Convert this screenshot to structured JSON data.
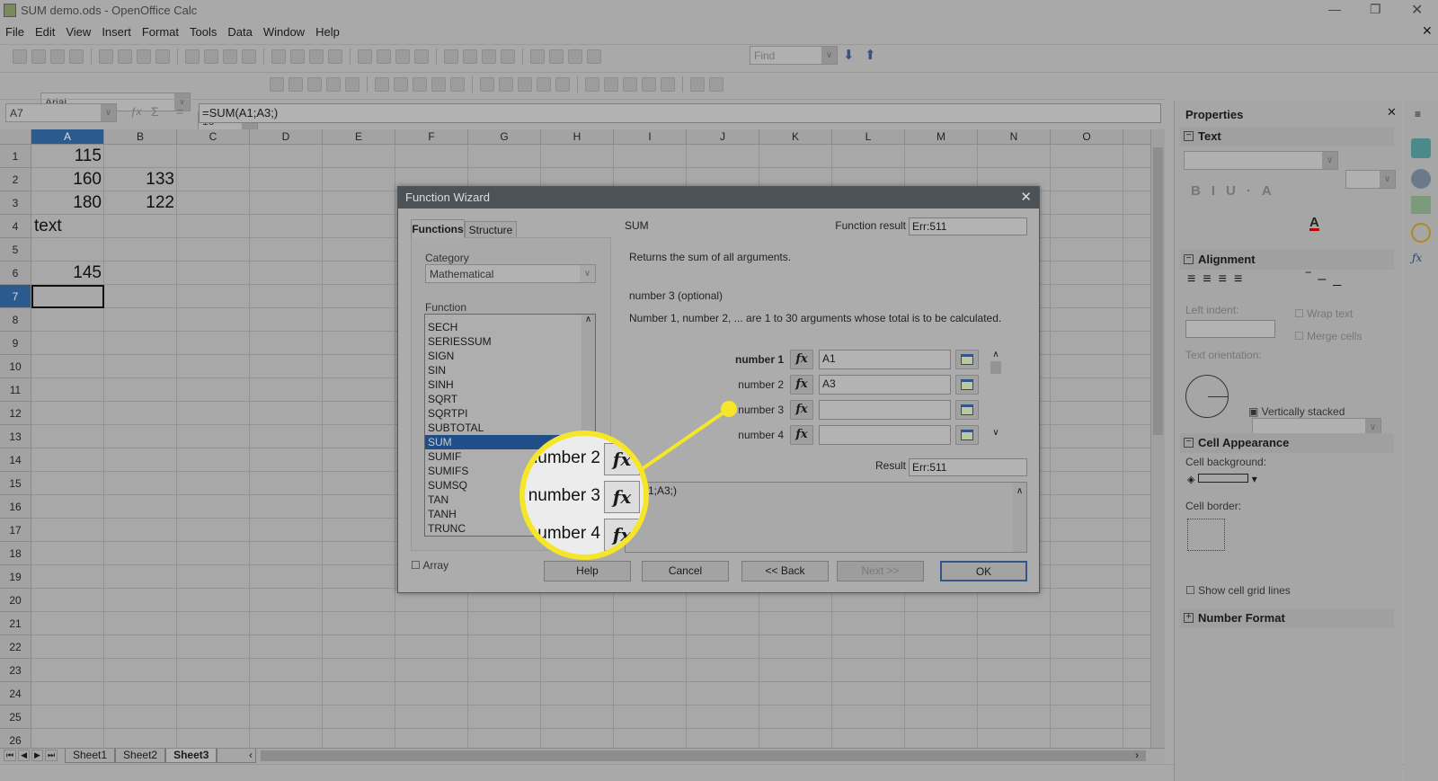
{
  "window": {
    "title": "SUM demo.ods - OpenOffice Calc"
  },
  "menu": [
    "File",
    "Edit",
    "View",
    "Insert",
    "Format",
    "Tools",
    "Data",
    "Window",
    "Help"
  ],
  "toolbar": {
    "find_placeholder": "Find",
    "font_name": "Arial",
    "font_size": "16"
  },
  "formula_bar": {
    "name_box": "A7",
    "formula": "=SUM(A1;A3;)"
  },
  "grid": {
    "columns": [
      "A",
      "B",
      "C",
      "D",
      "E",
      "F",
      "G",
      "H",
      "I",
      "J",
      "K",
      "L",
      "M",
      "N",
      "O"
    ],
    "row_count": 26,
    "selected_cell": "A7",
    "cells": [
      {
        "ref": "A1",
        "row": 1,
        "col": 0,
        "value": "115",
        "align": "right"
      },
      {
        "ref": "A2",
        "row": 2,
        "col": 0,
        "value": "160",
        "align": "right"
      },
      {
        "ref": "B2",
        "row": 2,
        "col": 1,
        "value": "133",
        "align": "right"
      },
      {
        "ref": "A3",
        "row": 3,
        "col": 0,
        "value": "180",
        "align": "right"
      },
      {
        "ref": "B3",
        "row": 3,
        "col": 1,
        "value": "122",
        "align": "right"
      },
      {
        "ref": "A4",
        "row": 4,
        "col": 0,
        "value": "text",
        "align": "left"
      },
      {
        "ref": "A6",
        "row": 6,
        "col": 0,
        "value": "145",
        "align": "right"
      }
    ]
  },
  "sheets": {
    "tabs": [
      "Sheet1",
      "Sheet2",
      "Sheet3"
    ],
    "active": "Sheet3"
  },
  "dialog": {
    "title": "Function Wizard",
    "tabs": [
      "Functions",
      "Structure"
    ],
    "category_label": "Category",
    "category_value": "Mathematical",
    "function_label": "Function",
    "functions": [
      "SECH",
      "SERIESSUM",
      "SIGN",
      "SIN",
      "SINH",
      "SQRT",
      "SQRTPI",
      "SUBTOTAL",
      "SUM",
      "SUMIF",
      "SUMIFS",
      "SUMSQ",
      "TAN",
      "TANH",
      "TRUNC"
    ],
    "selected_function": "SUM",
    "array_label": "Array",
    "function_name": "SUM",
    "function_result_label": "Function result",
    "function_result": "Err:511",
    "description": "Returns the sum of all arguments.",
    "arg_title": "number 3 (optional)",
    "arg_description": "Number 1, number 2, ... are 1 to 30 arguments whose total is to be calculated.",
    "args": [
      {
        "label": "number 1",
        "value": "A1"
      },
      {
        "label": "number 2",
        "value": "A3"
      },
      {
        "label": "number 3",
        "value": ""
      },
      {
        "label": "number 4",
        "value": ""
      }
    ],
    "formula_label": "ula",
    "formula": "M(A1;A3;)",
    "result_label": "Result",
    "result": "Err:511",
    "buttons": {
      "help": "Help",
      "cancel": "Cancel",
      "back": "<< Back",
      "next": "Next >>",
      "ok": "OK"
    }
  },
  "callout": {
    "labels": [
      "number 2",
      "number 3",
      "number 4"
    ],
    "color": "#f5e62a"
  },
  "sidebar": {
    "title": "Properties",
    "text_section": "Text",
    "alignment_section": "Alignment",
    "left_indent": "Left indent:",
    "wrap_text": "Wrap text",
    "merge_cells": "Merge cells",
    "text_orientation": "Text orientation:",
    "vertically_stacked": "Vertically stacked",
    "cell_appearance_section": "Cell Appearance",
    "cell_background": "Cell background:",
    "cell_border": "Cell border:",
    "show_grid": "Show cell grid lines",
    "number_format_section": "Number Format"
  },
  "colors": {
    "dialog_title": "#4b5358",
    "selection": "#1f4f86",
    "accent_highlight": "#f5e62a"
  }
}
